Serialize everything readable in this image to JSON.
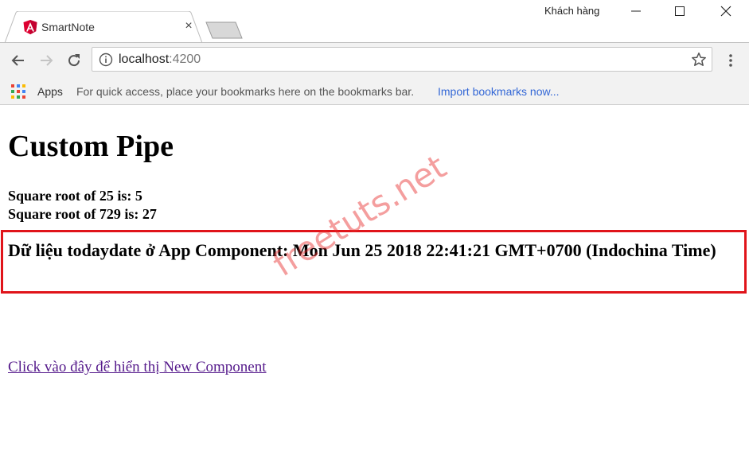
{
  "window": {
    "profile_name": "Khách hàng"
  },
  "tab": {
    "title": "SmartNote",
    "close_glyph": "×"
  },
  "toolbar": {
    "url_host": "localhost",
    "url_port": ":4200"
  },
  "bookmarks": {
    "apps_label": "Apps",
    "hint": "For quick access, place your bookmarks here on the bookmarks bar.",
    "import_link": "Import bookmarks now..."
  },
  "page": {
    "heading": "Custom Pipe",
    "sqrt_lines": [
      "Square root of 25 is: 5",
      "Square root of 729 is: 27"
    ],
    "today_data": "Dữ liệu todaydate ở App Component: Mon Jun 25 2018 22:41:21 GMT+0700 (Indochina Time)",
    "link": "Click vào đây để hiển thị New Component",
    "watermark": "freetuts.net"
  },
  "colors": {
    "highlight_border": "#e0141a",
    "link_visited": "#551a8b",
    "bookmark_link": "#3367d6",
    "angular_red": "#dd0031"
  },
  "icons": [
    "angular-icon",
    "close-icon",
    "new-tab-icon",
    "minimize-icon",
    "maximize-icon",
    "window-close-icon",
    "back-icon",
    "forward-icon",
    "reload-icon",
    "info-icon",
    "star-icon",
    "menu-icon",
    "apps-grid-icon"
  ]
}
